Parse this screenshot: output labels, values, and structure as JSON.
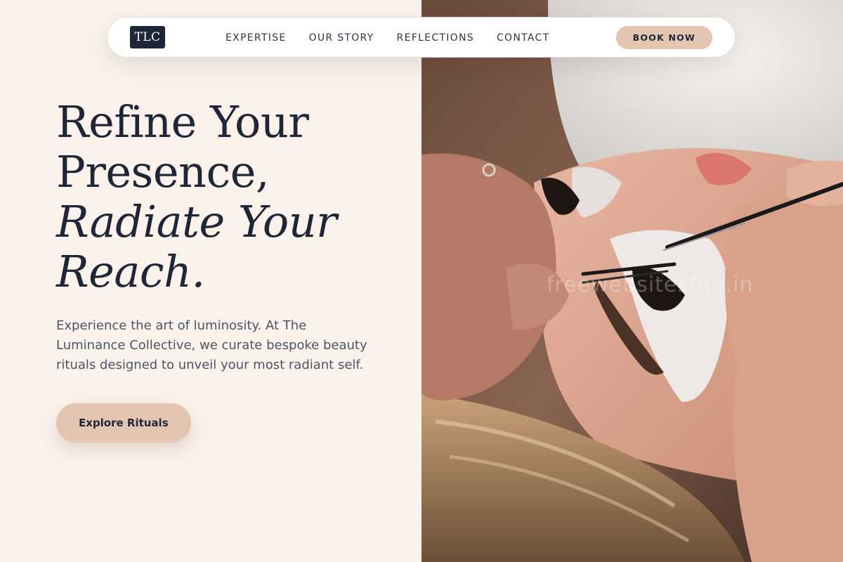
{
  "brand": {
    "logo_text": "TLC"
  },
  "nav": {
    "links": [
      "EXPERTISE",
      "OUR STORY",
      "REFLECTIONS",
      "CONTACT"
    ],
    "cta_label": "BOOK NOW"
  },
  "hero": {
    "title_line_1": "Refine Your",
    "title_line_2": "Presence,",
    "title_line_3": "Radiate Your",
    "title_line_4": "Reach.",
    "description": "Experience the art of luminosity. At The Luminance Collective, we curate bespoke beauty rituals designed to unveil your most radiant self.",
    "cta_label": "Explore Rituals"
  },
  "photo": {
    "watermark": "freewebsitesfun.in"
  },
  "colors": {
    "background": "#FBF2EC",
    "navy": "#1E2638",
    "accent": "#E3C5B1",
    "body_text": "#4D5565"
  },
  "icons": {
    "logo": "tlc-monogram"
  }
}
